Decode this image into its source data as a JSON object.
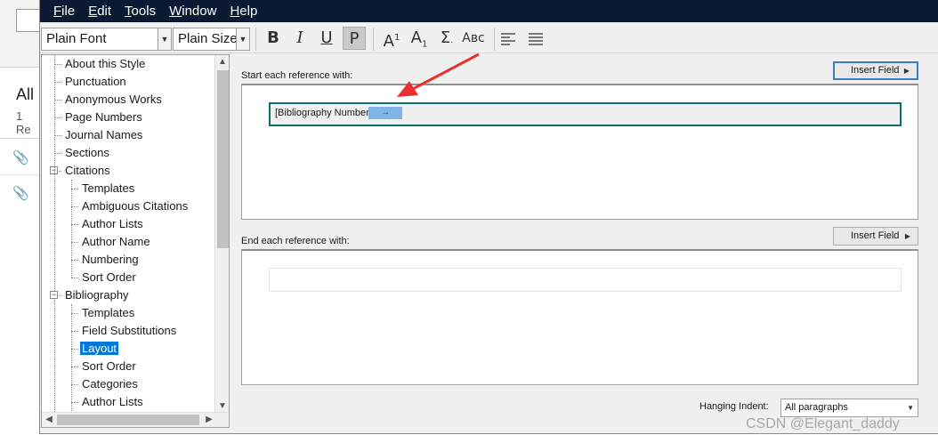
{
  "background": {
    "heading": "All",
    "count": "1 Re"
  },
  "menu": [
    {
      "label": "File",
      "mnemonic": "F",
      "rest": "ile"
    },
    {
      "label": "Edit",
      "mnemonic": "E",
      "rest": "dit"
    },
    {
      "label": "Tools",
      "mnemonic": "T",
      "rest": "ools"
    },
    {
      "label": "Window",
      "mnemonic": "W",
      "rest": "indow"
    },
    {
      "label": "Help",
      "mnemonic": "H",
      "rest": "elp"
    }
  ],
  "toolbar": {
    "font": "Plain Font",
    "size": "Plain Size",
    "bold": "B",
    "italic": "I",
    "underline": "U",
    "plain": "P",
    "superscript": "A",
    "superscript_mark": "1",
    "subscript": "A",
    "subscript_mark": "1",
    "symbol": "Σ",
    "smallcaps": "Aʙᴄ"
  },
  "tree": [
    {
      "label": "About this Style",
      "level": 0
    },
    {
      "label": "Punctuation",
      "level": 0
    },
    {
      "label": "Anonymous Works",
      "level": 0
    },
    {
      "label": "Page Numbers",
      "level": 0
    },
    {
      "label": "Journal Names",
      "level": 0
    },
    {
      "label": "Sections",
      "level": 0
    },
    {
      "label": "Citations",
      "level": 0,
      "expanded": true
    },
    {
      "label": "Templates",
      "level": 1
    },
    {
      "label": "Ambiguous Citations",
      "level": 1
    },
    {
      "label": "Author Lists",
      "level": 1
    },
    {
      "label": "Author Name",
      "level": 1
    },
    {
      "label": "Numbering",
      "level": 1
    },
    {
      "label": "Sort Order",
      "level": 1
    },
    {
      "label": "Bibliography",
      "level": 0,
      "expanded": true
    },
    {
      "label": "Templates",
      "level": 1
    },
    {
      "label": "Field Substitutions",
      "level": 1
    },
    {
      "label": "Layout",
      "level": 1,
      "selected": true
    },
    {
      "label": "Sort Order",
      "level": 1
    },
    {
      "label": "Categories",
      "level": 1
    },
    {
      "label": "Author Lists",
      "level": 1
    }
  ],
  "layout": {
    "start_label": "Start each reference with:",
    "end_label": "End each reference with:",
    "insert_field": "Insert Field",
    "start_token": "[Bibliography Number]",
    "tab_mark": "→",
    "hanging_label": "Hanging Indent:",
    "hanging_value": "All paragraphs"
  },
  "watermark": "CSDN @Elegant_daddy",
  "colors": {
    "menubar": "#0b1a33",
    "selection": "#0078d7",
    "arrow": "#e8312f",
    "start_border": "#0f6e6e"
  }
}
